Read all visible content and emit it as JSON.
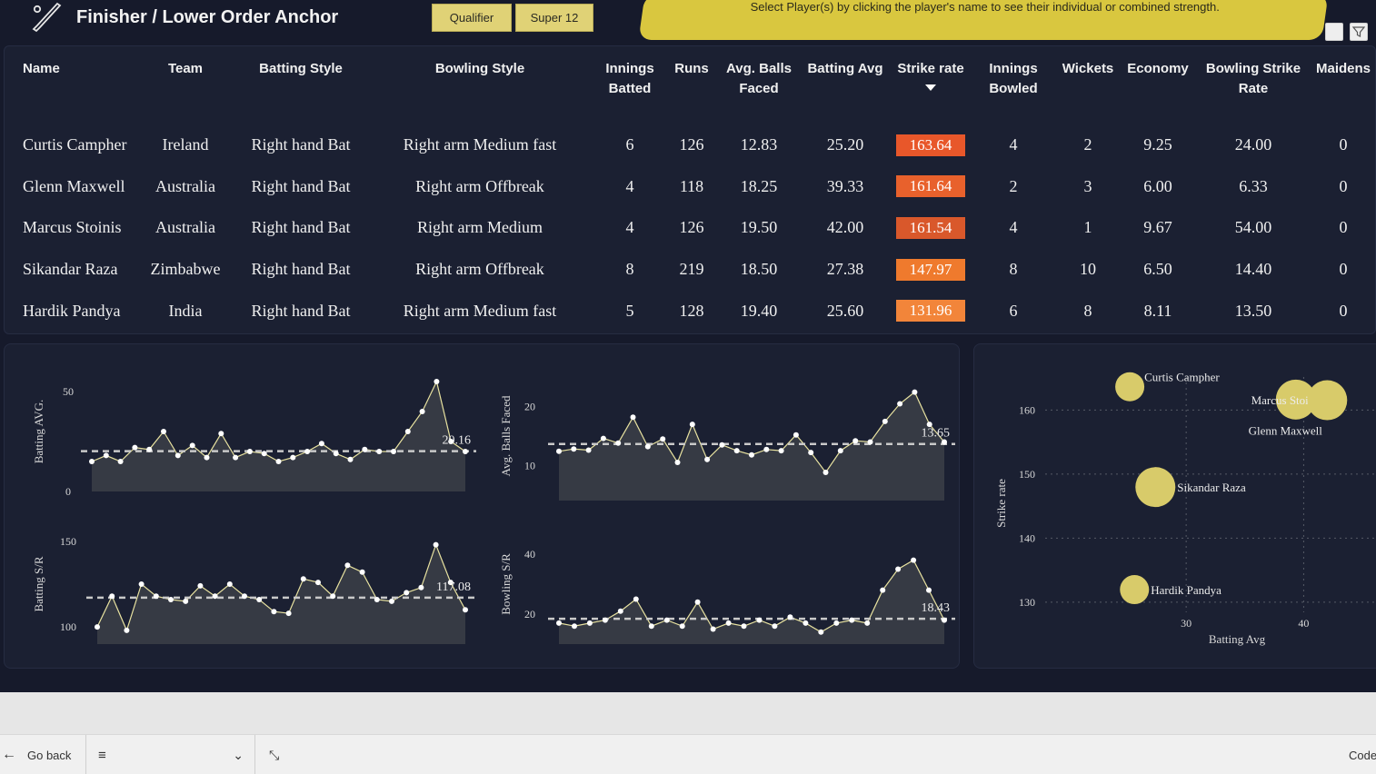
{
  "header": {
    "title": "Finisher / Lower Order Anchor",
    "slicers": [
      "Qualifier",
      "Super 12"
    ],
    "banner": "Select Player(s) by clicking the player's name to see their individual or combined strength."
  },
  "table": {
    "columns": [
      "Name",
      "Team",
      "Batting Style",
      "Bowling Style",
      "Innings Batted",
      "Runs",
      "Avg. Balls Faced",
      "Batting Avg",
      "Strike rate",
      "Innings Bowled",
      "Wickets",
      "Economy",
      "Bowling Strike Rate",
      "Maidens"
    ],
    "rows": [
      [
        "Curtis Campher",
        "Ireland",
        "Right hand Bat",
        "Right arm Medium fast",
        "6",
        "126",
        "12.83",
        "25.20",
        "163.64",
        "4",
        "2",
        "9.25",
        "24.00",
        "0"
      ],
      [
        "Glenn Maxwell",
        "Australia",
        "Right hand Bat",
        "Right arm Offbreak",
        "4",
        "118",
        "18.25",
        "39.33",
        "161.64",
        "2",
        "3",
        "6.00",
        "6.33",
        "0"
      ],
      [
        "Marcus Stoinis",
        "Australia",
        "Right hand Bat",
        "Right arm Medium",
        "4",
        "126",
        "19.50",
        "42.00",
        "161.54",
        "4",
        "1",
        "9.67",
        "54.00",
        "0"
      ],
      [
        "Sikandar Raza",
        "Zimbabwe",
        "Right hand Bat",
        "Right arm Offbreak",
        "8",
        "219",
        "18.50",
        "27.38",
        "147.97",
        "8",
        "10",
        "6.50",
        "14.40",
        "0"
      ],
      [
        "Hardik Pandya",
        "India",
        "Right hand Bat",
        "Right arm Medium fast",
        "5",
        "128",
        "19.40",
        "25.60",
        "131.96",
        "6",
        "8",
        "8.11",
        "13.50",
        "0"
      ]
    ],
    "strike_rate_colors": [
      "#e8572a",
      "#e8612c",
      "#d9582b",
      "#ef7a2d",
      "#f2853a"
    ]
  },
  "colors": {
    "background": "#161a2b",
    "panel": "#1b2032",
    "accent": "#e0d276",
    "bubble": "#d8cb6a"
  },
  "bottom_bar": {
    "go_back": "Go back",
    "right_text": "Code"
  },
  "chart_data": [
    {
      "type": "area",
      "ylabel": "Batting AVG.",
      "yticks": [
        0,
        50
      ],
      "ylim": [
        0,
        60
      ],
      "avg_line": 20.16,
      "avg_label": "20.16",
      "values": [
        15,
        18,
        15,
        22,
        21,
        30,
        18,
        23,
        17,
        29,
        17,
        20,
        19,
        15,
        17,
        20,
        24,
        19,
        16,
        21,
        20,
        20,
        30,
        40,
        55,
        25,
        20
      ]
    },
    {
      "type": "area",
      "ylabel": "Avg. Balls Faced",
      "yticks": [
        10,
        20
      ],
      "ylim": [
        4,
        26
      ],
      "avg_line": 13.65,
      "avg_label": "13.65",
      "values": [
        12.4,
        12.8,
        12.6,
        14.6,
        13.8,
        18.2,
        13.2,
        14.5,
        10.5,
        17.0,
        11.0,
        13.5,
        12.5,
        11.8,
        12.7,
        12.5,
        15.2,
        12.2,
        8.8,
        12.5,
        14.2,
        14.0,
        17.5,
        20.5,
        22.5,
        17.0,
        14.0
      ]
    },
    {
      "type": "area",
      "ylabel": "Batting S/R",
      "yticks": [
        100,
        150
      ],
      "ylim": [
        90,
        160
      ],
      "avg_line": 117.08,
      "avg_label": "117.08",
      "values": [
        100,
        118,
        98,
        125,
        118,
        116,
        115,
        124,
        118,
        125,
        118,
        116,
        109,
        108,
        128,
        126,
        118,
        136,
        132,
        116,
        115,
        120,
        123,
        148,
        126,
        110
      ]
    },
    {
      "type": "area",
      "ylabel": "Bowling S/R",
      "yticks": [
        20,
        40
      ],
      "ylim": [
        10,
        50
      ],
      "avg_line": 18.43,
      "avg_label": "18.43",
      "values": [
        17,
        16,
        17,
        18,
        21,
        25,
        16,
        18,
        16,
        24,
        15,
        17,
        16,
        18,
        16,
        19,
        17,
        14,
        17,
        18,
        17,
        28,
        35,
        38,
        28,
        18
      ]
    },
    {
      "type": "scatter",
      "xlabel": "Batting Avg",
      "ylabel": "Strike rate",
      "xticks": [
        30,
        40
      ],
      "yticks": [
        130,
        140,
        150,
        160
      ],
      "xlim": [
        18,
        46
      ],
      "ylim": [
        127,
        168
      ],
      "points": [
        {
          "name": "Curtis Campher",
          "x": 25.2,
          "y": 163.64
        },
        {
          "name": "Marcus Stoinis",
          "x": 39.33,
          "y": 161.64
        },
        {
          "name": "Glenn Maxwell",
          "x": 42.0,
          "y": 161.54
        },
        {
          "name": "Sikandar Raza",
          "x": 27.38,
          "y": 147.97
        },
        {
          "name": "Hardik Pandya",
          "x": 25.6,
          "y": 131.96
        }
      ]
    }
  ]
}
